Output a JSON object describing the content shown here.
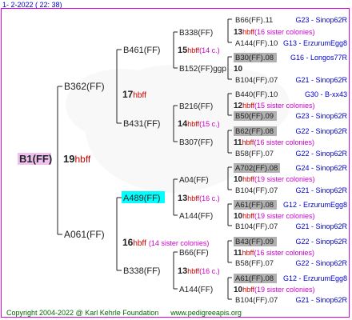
{
  "header": {
    "date": "1-  2-2022 (  22:  38)"
  },
  "footer": {
    "copyright": "Copyright 2004-2022 @ Karl Kehrle Foundation",
    "website": "www.pedigreeapis.org"
  },
  "colors": {
    "frame": "#e000e0",
    "root_bg": "#f0c0f0",
    "highlight_bg": "#00ffff",
    "hbff": "#cc0000",
    "sister": "#cc00cc",
    "origin": "#0000cc",
    "grey_bg": "#b0b0b0",
    "footer": "#006600"
  },
  "pedigree": {
    "root": {
      "name": "B1(FF)",
      "year": "19",
      "breeder": "hbff"
    },
    "gen1": [
      {
        "name": "B362(FF)",
        "year": "17",
        "breeder": "hbff",
        "note": ""
      },
      {
        "name": "A061(FF)",
        "year": "16",
        "breeder": "hbff",
        "note": "(14 sister colonies)"
      }
    ],
    "gen2": [
      {
        "name": "B461(FF)",
        "year": "",
        "breeder": "",
        "note": ""
      },
      {
        "name": "B431(FF)",
        "year": "",
        "breeder": "",
        "note": ""
      },
      {
        "name": "A489(FF)",
        "year": "",
        "breeder": "",
        "note": ""
      },
      {
        "name": "B338(FF)",
        "year": "",
        "breeder": "",
        "note": ""
      }
    ],
    "gen2_mid": [
      {
        "year": "15",
        "breeder": "hbff",
        "note": "(14 c.)"
      },
      {
        "year": "14",
        "breeder": "hbff",
        "note": "(15 c.)"
      },
      {
        "year": "13",
        "breeder": "hbff",
        "note": "(16 c.)"
      },
      {
        "year": "13",
        "breeder": "hbff",
        "note": "(16 c.)"
      }
    ],
    "gen3": [
      {
        "name": "B338(FF)"
      },
      {
        "name": "B152(FF)ggp"
      },
      {
        "name": "B216(FF)"
      },
      {
        "name": "B307(FF)"
      },
      {
        "name": "A04(FF)"
      },
      {
        "name": "A144(FF)"
      },
      {
        "name": "B66(FF)"
      },
      {
        "name": "A144(FF)"
      }
    ],
    "gen3_mid": [
      {
        "year": "13",
        "breeder": "hbff",
        "note": "(16 sister colonies)"
      },
      {
        "year": "10",
        "breeder": "",
        "note": ""
      },
      {
        "year": "12",
        "breeder": "hbff",
        "note": "(15 sister colonies)"
      },
      {
        "year": "11",
        "breeder": "hbff",
        "note": "(16 sister colonies)"
      },
      {
        "year": "10",
        "breeder": "hbff",
        "note": "(19 sister colonies)"
      },
      {
        "year": "10",
        "breeder": "hbff",
        "note": "(19 sister colonies)"
      },
      {
        "year": "11",
        "breeder": "hbff",
        "note": "(16 sister colonies)"
      },
      {
        "year": "10",
        "breeder": "hbff",
        "note": "(19 sister colonies)"
      }
    ],
    "gen4": [
      {
        "name": "B66(FF).11",
        "origin": "G23 - Sinop62R"
      },
      {
        "name": "A144(FF).10",
        "origin": "G13 - ErzurumEgg8"
      },
      {
        "name": "B30(FF).08",
        "origin": "G16 - Longos77R"
      },
      {
        "name": "B104(FF).07",
        "origin": "G21 - Sinop62R"
      },
      {
        "name": "B440(FF).10",
        "origin": "G30 - B-xx43"
      },
      {
        "name": "B50(FF).09",
        "origin": "G23 - Sinop62R"
      },
      {
        "name": "B62(FF).08",
        "origin": "G22 - Sinop62R"
      },
      {
        "name": "B58(FF).07",
        "origin": "G22 - Sinop62R"
      },
      {
        "name": "A702(FF).08",
        "origin": "G24 - Sinop62R"
      },
      {
        "name": "B104(FF).07",
        "origin": "G21 - Sinop62R"
      },
      {
        "name": "A61(FF).08",
        "origin": "G12 - ErzurumEgg8"
      },
      {
        "name": "B104(FF).07",
        "origin": "G21 - Sinop62R"
      },
      {
        "name": "B43(FF).09",
        "origin": "G22 - Sinop62R"
      },
      {
        "name": "B58(FF).07",
        "origin": "G22 - Sinop62R"
      },
      {
        "name": "A61(FF).08",
        "origin": "G12 - ErzurumEgg8"
      },
      {
        "name": "B104(FF).07",
        "origin": "G21 - Sinop62R"
      }
    ]
  }
}
